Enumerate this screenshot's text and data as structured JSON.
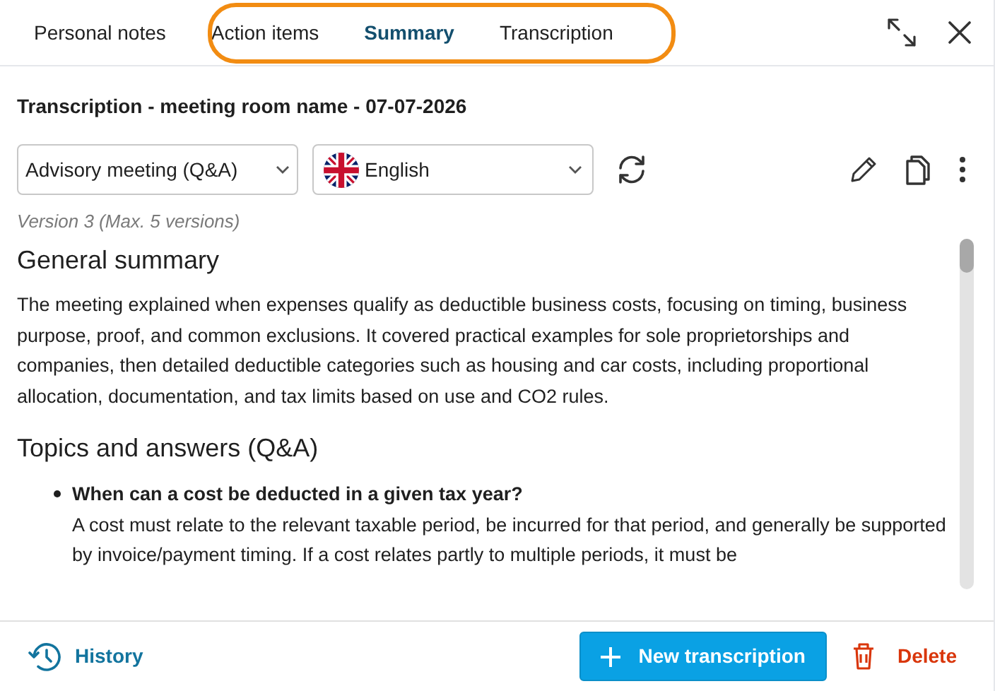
{
  "tabs": [
    {
      "label": "Personal notes",
      "selected": false
    },
    {
      "label": "Action items",
      "selected": false
    },
    {
      "label": "Summary",
      "selected": true
    },
    {
      "label": "Transcription",
      "selected": false
    }
  ],
  "title": "Transcription - meeting room name - 07-07-2026",
  "template_select": {
    "value": "Advisory meeting (Q&A)"
  },
  "language_select": {
    "value": "English"
  },
  "version_note": "Version 3 (Max. 5 versions)",
  "summary": {
    "heading": "General summary",
    "paragraph": "The meeting explained when expenses qualify as deductible business costs, focusing on timing, business purpose, proof, and common exclusions. It covered practical examples for sole proprietorships and companies, then detailed deductible categories such as housing and car costs, including proportional allocation, documentation, and tax limits based on use and CO2 rules."
  },
  "qa": {
    "heading": "Topics and answers (Q&A)",
    "items": [
      {
        "question": "When can a cost be deducted in a given tax year?",
        "answer": "A cost must relate to the relevant taxable period, be incurred for that period, and generally be supported by invoice/payment timing. If a cost relates partly to multiple periods, it must be"
      }
    ]
  },
  "footer": {
    "history": "History",
    "new_button": "New transcription",
    "delete": "Delete"
  }
}
